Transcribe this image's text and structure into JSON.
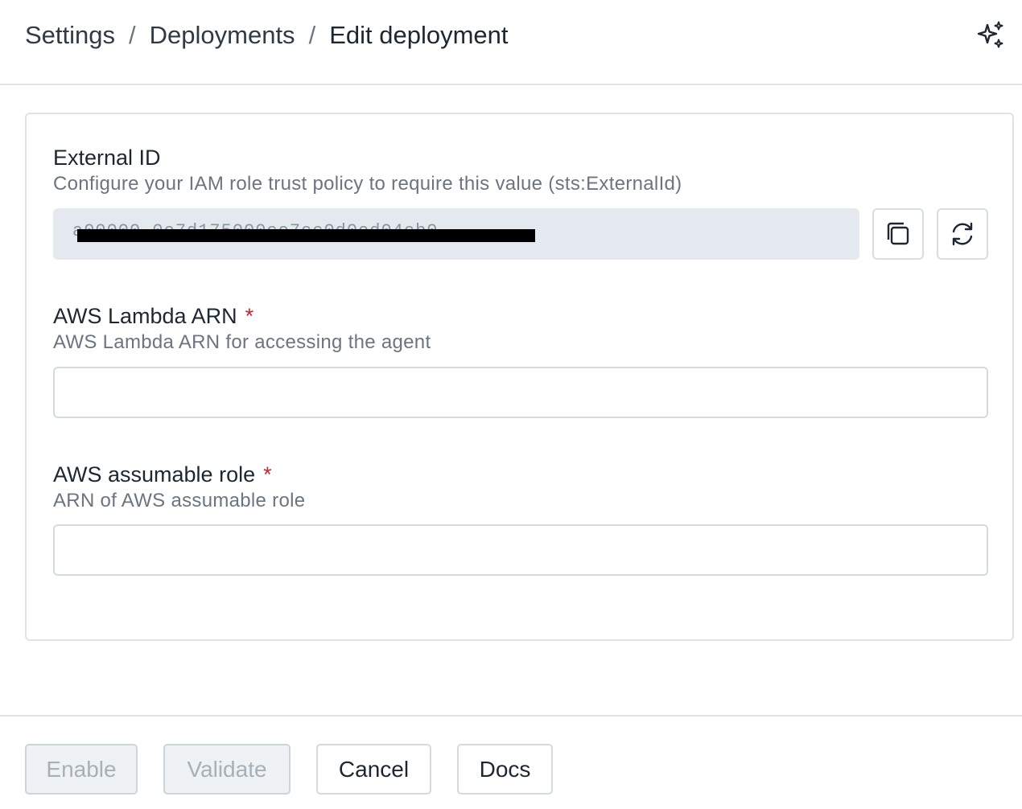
{
  "breadcrumb": {
    "settings": "Settings",
    "deployments": "Deployments",
    "current": "Edit deployment",
    "separator": "/"
  },
  "header": {
    "assistant_icon": "sparkle-icon"
  },
  "external_id": {
    "label": "External ID",
    "help": "Configure your IAM role trust policy to require this value (sts:ExternalId)",
    "value": "a00000-0e7d175000ce7cc0d0ed04cb0",
    "copy_icon": "copy-icon",
    "regenerate_icon": "refresh-icon"
  },
  "lambda_arn": {
    "label": "AWS Lambda ARN",
    "required_mark": "*",
    "help": "AWS Lambda ARN for accessing the agent",
    "value": ""
  },
  "assumable_role": {
    "label": "AWS assumable role",
    "required_mark": "*",
    "help": "ARN of AWS assumable role",
    "value": ""
  },
  "footer": {
    "enable": "Enable",
    "validate": "Validate",
    "cancel": "Cancel",
    "docs": "Docs"
  },
  "colors": {
    "required": "#c0282d",
    "readonly_bg": "#e3e9ef",
    "border": "#dde3e8"
  }
}
